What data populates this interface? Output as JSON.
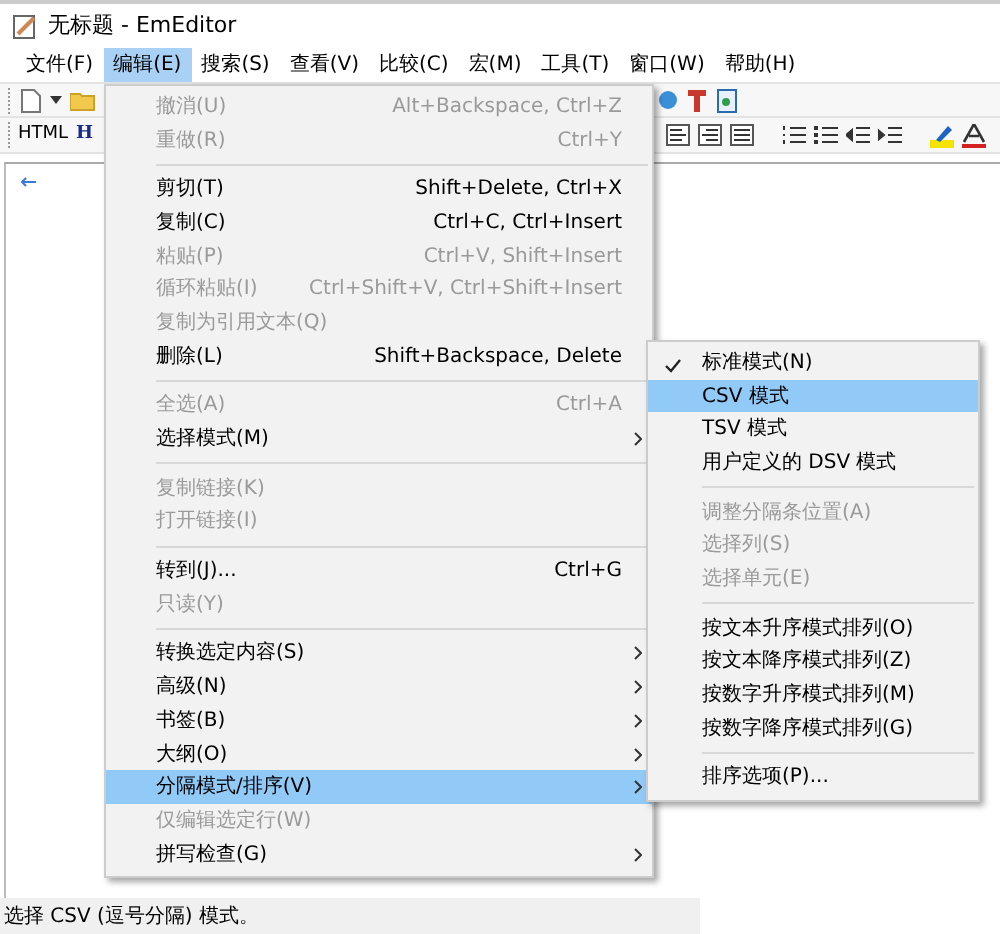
{
  "window": {
    "title": "无标题 - EmEditor"
  },
  "menu_bar": [
    {
      "label": "文件(F)",
      "selected": false
    },
    {
      "label": "编辑(E)",
      "selected": true
    },
    {
      "label": "搜索(S)",
      "selected": false
    },
    {
      "label": "查看(V)",
      "selected": false
    },
    {
      "label": "比较(C)",
      "selected": false
    },
    {
      "label": "宏(M)",
      "selected": false
    },
    {
      "label": "工具(T)",
      "selected": false
    },
    {
      "label": "窗口(W)",
      "selected": false
    },
    {
      "label": "帮助(H)",
      "selected": false
    }
  ],
  "toolbar_2": {
    "labels": [
      "HTML",
      "H"
    ]
  },
  "edit_menu": [
    {
      "kind": "item",
      "label": "撤消(U)",
      "shortcut": "Alt+Backspace, Ctrl+Z",
      "disabled": true
    },
    {
      "kind": "item",
      "label": "重做(R)",
      "shortcut": "Ctrl+Y",
      "disabled": true
    },
    {
      "kind": "separator"
    },
    {
      "kind": "item",
      "label": "剪切(T)",
      "shortcut": "Shift+Delete, Ctrl+X",
      "disabled": false
    },
    {
      "kind": "item",
      "label": "复制(C)",
      "shortcut": "Ctrl+C, Ctrl+Insert",
      "disabled": false
    },
    {
      "kind": "item",
      "label": "粘贴(P)",
      "shortcut": "Ctrl+V, Shift+Insert",
      "disabled": true
    },
    {
      "kind": "item",
      "label": "循环粘贴(I)",
      "shortcut": "Ctrl+Shift+V, Ctrl+Shift+Insert",
      "disabled": true
    },
    {
      "kind": "item",
      "label": "复制为引用文本(Q)",
      "disabled": true
    },
    {
      "kind": "item",
      "label": "删除(L)",
      "shortcut": "Shift+Backspace, Delete",
      "disabled": false
    },
    {
      "kind": "separator"
    },
    {
      "kind": "item",
      "label": "全选(A)",
      "shortcut": "Ctrl+A",
      "disabled": true
    },
    {
      "kind": "item",
      "label": "选择模式(M)",
      "disabled": false,
      "has_submenu": true
    },
    {
      "kind": "separator"
    },
    {
      "kind": "item",
      "label": "复制链接(K)",
      "disabled": true
    },
    {
      "kind": "item",
      "label": "打开链接(I)",
      "disabled": true
    },
    {
      "kind": "separator"
    },
    {
      "kind": "item",
      "label": "转到(J)...",
      "shortcut": "Ctrl+G",
      "disabled": false
    },
    {
      "kind": "item",
      "label": "只读(Y)",
      "disabled": true
    },
    {
      "kind": "separator"
    },
    {
      "kind": "item",
      "label": "转换选定内容(S)",
      "disabled": false,
      "has_submenu": true
    },
    {
      "kind": "item",
      "label": "高级(N)",
      "disabled": false,
      "has_submenu": true
    },
    {
      "kind": "item",
      "label": "书签(B)",
      "disabled": false,
      "has_submenu": true
    },
    {
      "kind": "item",
      "label": "大纲(O)",
      "disabled": false,
      "has_submenu": true
    },
    {
      "kind": "item",
      "label": "分隔模式/排序(V)",
      "disabled": false,
      "has_submenu": true,
      "selected": true
    },
    {
      "kind": "item",
      "label": "仅编辑选定行(W)",
      "disabled": true
    },
    {
      "kind": "item",
      "label": "拼写检查(G)",
      "disabled": false,
      "has_submenu": true
    }
  ],
  "submenu": [
    {
      "kind": "item",
      "label": "标准模式(N)",
      "disabled": false,
      "checked": true
    },
    {
      "kind": "item",
      "label": "CSV 模式",
      "disabled": false,
      "selected": true
    },
    {
      "kind": "item",
      "label": "TSV 模式",
      "disabled": false
    },
    {
      "kind": "item",
      "label": "用户定义的 DSV 模式",
      "disabled": false
    },
    {
      "kind": "separator"
    },
    {
      "kind": "item",
      "label": "调整分隔条位置(A)",
      "disabled": true
    },
    {
      "kind": "item",
      "label": "选择列(S)",
      "disabled": true
    },
    {
      "kind": "item",
      "label": "选择单元(E)",
      "disabled": true
    },
    {
      "kind": "separator"
    },
    {
      "kind": "item",
      "label": "按文本升序模式排列(O)",
      "disabled": false
    },
    {
      "kind": "item",
      "label": "按文本降序模式排列(Z)",
      "disabled": false
    },
    {
      "kind": "item",
      "label": "按数字升序模式排列(M)",
      "disabled": false
    },
    {
      "kind": "item",
      "label": "按数字降序模式排列(G)",
      "disabled": false
    },
    {
      "kind": "separator"
    },
    {
      "kind": "item",
      "label": "排序选项(P)...",
      "disabled": false
    }
  ],
  "status_bar": "选择 CSV (逗号分隔) 模式。"
}
